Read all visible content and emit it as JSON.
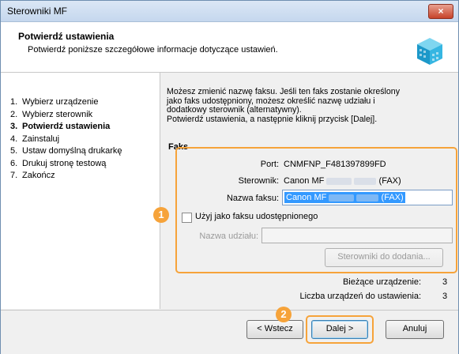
{
  "window": {
    "title": "Sterowniki MF",
    "close_label": "×"
  },
  "header": {
    "title": "Potwierdź ustawienia",
    "subtitle": "Potwierdź poniższe szczegółowe informacje dotyczące ustawień."
  },
  "steps": [
    {
      "num": "1.",
      "label": "Wybierz urządzenie",
      "active": false
    },
    {
      "num": "2.",
      "label": "Wybierz sterownik",
      "active": false
    },
    {
      "num": "3.",
      "label": "Potwierdź ustawienia",
      "active": true
    },
    {
      "num": "4.",
      "label": "Zainstaluj",
      "active": false
    },
    {
      "num": "5.",
      "label": "Ustaw domyślną drukarkę",
      "active": false
    },
    {
      "num": "6.",
      "label": "Drukuj stronę testową",
      "active": false
    },
    {
      "num": "7.",
      "label": "Zakończ",
      "active": false
    }
  ],
  "main": {
    "description_lines": [
      "Możesz zmienić nazwę faksu. Jeśli ten faks zostanie określony",
      "jako faks udostępniony, możesz określić nazwę udziału i",
      "dodatkowy sterownik (alternatywny).",
      "Potwierdź ustawienia, a następnie kliknij przycisk [Dalej]."
    ],
    "section_title": "Faks",
    "port_label": "Port:",
    "port_value": "CNMFNP_F481397899FD",
    "driver_label": "Sterownik:",
    "driver_value_prefix": "Canon MF",
    "driver_value_suffix": "(FAX)",
    "fax_name_label": "Nazwa faksu:",
    "fax_name_prefix": "Canon MF",
    "fax_name_suffix": "(FAX)",
    "share_checkbox_label": "Użyj jako faksu udostępnionego",
    "share_checked": false,
    "share_name_label": "Nazwa udziału:",
    "share_name_value": "",
    "additional_drivers_button": "Sterowniki do dodania...",
    "current_device_label": "Bieżące urządzenie:",
    "current_device_value": "3",
    "devices_to_setup_label": "Liczba urządzeń do ustawienia:",
    "devices_to_setup_value": "3"
  },
  "footer": {
    "back_label": "< Wstecz",
    "next_label": "Dalej >",
    "cancel_label": "Anuluj"
  },
  "annotations": {
    "badge1": "1",
    "badge2": "2"
  },
  "colors": {
    "accent_orange": "#f6a33a",
    "selection_blue": "#3399ff"
  }
}
